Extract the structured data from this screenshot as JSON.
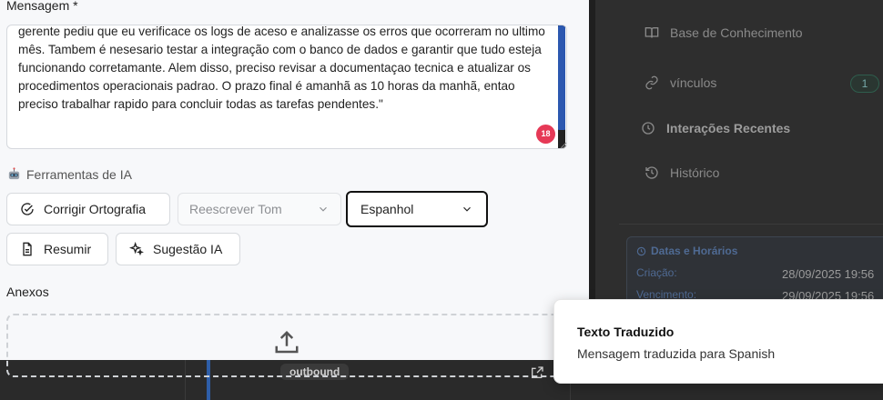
{
  "background": {
    "nav": [
      {
        "label": "Base de Conhecimento",
        "icon": "book-icon"
      },
      {
        "label": "vínculos",
        "icon": "link-icon",
        "count": "1"
      },
      {
        "label": "Interações Recentes",
        "icon": "clock-icon"
      },
      {
        "label": "Histórico",
        "icon": "history-icon"
      }
    ],
    "dates": {
      "title": "Datas e Horários",
      "created_label": "Criação:",
      "created_value": "28/09/2025 19:56",
      "due_label": "Vencimento:",
      "due_value": "29/09/2025 19:56"
    },
    "direction_tag": "outbound"
  },
  "form": {
    "message_label": "Mensagem *",
    "message_text": "gerente pediu que eu verificace os logs de aceso e analizasse os erros que ocorreram no ultimo mês. Tambem é nesesario testar a integração com o banco de dados e garantir que tudo esteja funcionando corretamante. Alem disso, preciso revisar a documentaçao tecnica e atualizar os procedimentos operacionais padrao. O prazo final é amanhã as 10 horas da manhã, entao preciso trabalhar rapido para concluir todas as tarefas pendentes.\"",
    "error_count": "18",
    "ai_tools_title": "Ferramentas de IA",
    "spell_button": "Corrigir Ortografia",
    "tone_select": "Reescrever Tom",
    "language_select": "Espanhol",
    "summarize_button": "Resumir",
    "suggest_button": "Sugestão IA",
    "attachments_label": "Anexos"
  },
  "toast": {
    "title": "Texto Traduzido",
    "description": "Mensagem traduzida para Spanish"
  },
  "colors": {
    "badge": "#e63956",
    "accent_blue": "#2c58b0"
  }
}
